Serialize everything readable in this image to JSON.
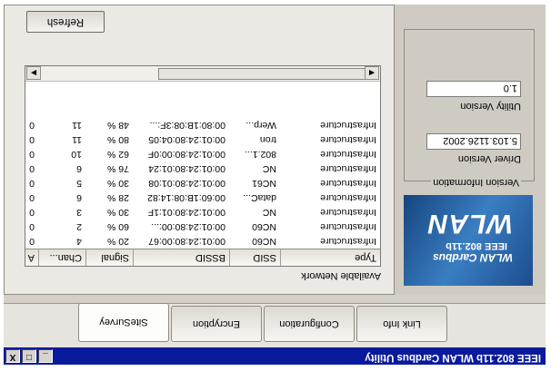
{
  "window": {
    "title": "IEEE 802.11b WLAN Cardbus Utility",
    "controls": [
      "_",
      "□",
      "X"
    ]
  },
  "tabs": [
    {
      "label": "Link Info",
      "active": false
    },
    {
      "label": "Configuration",
      "active": false
    },
    {
      "label": "Encryption",
      "active": false
    },
    {
      "label": "SiteSurvey",
      "active": true
    }
  ],
  "logo": {
    "line1": "WLAN",
    "line2": "IEEE 802.11b",
    "line3": "WLAN Cardbus"
  },
  "version": {
    "group_label": "Version Information",
    "driver_label": "Driver Version",
    "driver_value": "5.103.1126.2002",
    "utility_label": "Utility Version",
    "utility_value": "1.0"
  },
  "networks": {
    "label": "Available Network",
    "columns": [
      "Type",
      "SSID",
      "BSSID",
      "Signal",
      "Chan...",
      "A"
    ],
    "rows": [
      [
        "Infrastructure",
        "NC60",
        "00:01:24:80:00:67",
        "20 %",
        "4",
        "0"
      ],
      [
        "Infrastructure",
        "NC60",
        "00:01:24:80:00:...",
        "60 %",
        "2",
        "0"
      ],
      [
        "Infrastructure",
        "NC",
        "00:01:24:80:01:1F",
        "30 %",
        "3",
        "0"
      ],
      [
        "Infrastructure",
        "dataC...",
        "00:60:1B:08:14:82",
        "28 %",
        "6",
        "0"
      ],
      [
        "Infrastructure",
        "NC61",
        "00:01:24:80:01:08",
        "30 %",
        "5",
        "0"
      ],
      [
        "Infrastructure",
        "NC",
        "00:01:24:80:01:24",
        "76 %",
        "6",
        "0"
      ],
      [
        "Infrastructure",
        "802.1...",
        "00:01:24:80:00:0F",
        "62 %",
        "10",
        "0"
      ],
      [
        "Infrastructure",
        "tron",
        "00:01:24:80:04:05",
        "80 %",
        "11",
        "0"
      ],
      [
        "Infrastructure",
        "Werp...",
        "00:80:1B:08:3F:...",
        "48 %",
        "11",
        "0"
      ]
    ]
  },
  "refresh_label": "Refresh"
}
